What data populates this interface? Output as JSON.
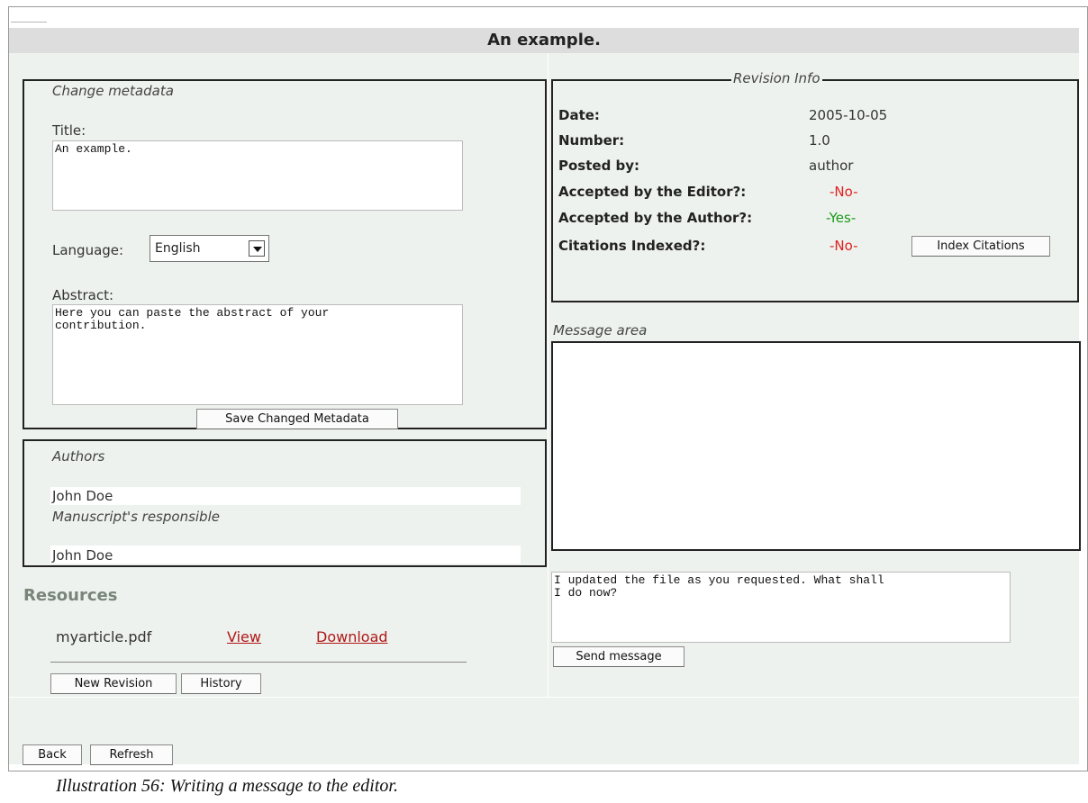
{
  "page": {
    "title": "An example."
  },
  "metadata": {
    "legend": "Change metadata",
    "title_label": "Title:",
    "title_value": "An example.",
    "language_label": "Language:",
    "language_value": "English",
    "abstract_label": "Abstract:",
    "abstract_value": "Here you can paste the abstract of your\ncontribution.",
    "save_label": "Save Changed Metadata"
  },
  "authors": {
    "legend": "Authors",
    "author": "John Doe",
    "responsible_label": "Manuscript's responsible",
    "responsible": "John Doe"
  },
  "resources": {
    "heading": "Resources",
    "file_name": "myarticle.pdf",
    "view_label": "View",
    "download_label": "Download",
    "new_revision_label": "New Revision",
    "history_label": "History"
  },
  "revision": {
    "legend": "Revision Info",
    "rows": [
      {
        "label": "Date:",
        "value": "2005-10-05"
      },
      {
        "label": "Number:",
        "value": "1.0"
      },
      {
        "label": "Posted by:",
        "value": "author"
      },
      {
        "label": "Accepted by the Editor?:",
        "value": "-No-"
      },
      {
        "label": "Accepted by the Author?:",
        "value": "-Yes-"
      },
      {
        "label": "Citations Indexed?:",
        "value": "-No-"
      }
    ],
    "index_citations_label": "Index Citations",
    "colors": {
      "no": "#e02020",
      "yes": "#1a9a1a"
    }
  },
  "messages": {
    "legend": "Message area",
    "draft": "I updated the file as you requested. What shall\nI do now?",
    "send_label": "Send message"
  },
  "footer": {
    "back_label": "Back",
    "refresh_label": "Refresh"
  },
  "caption": "Illustration 56: Writing a message to the editor."
}
